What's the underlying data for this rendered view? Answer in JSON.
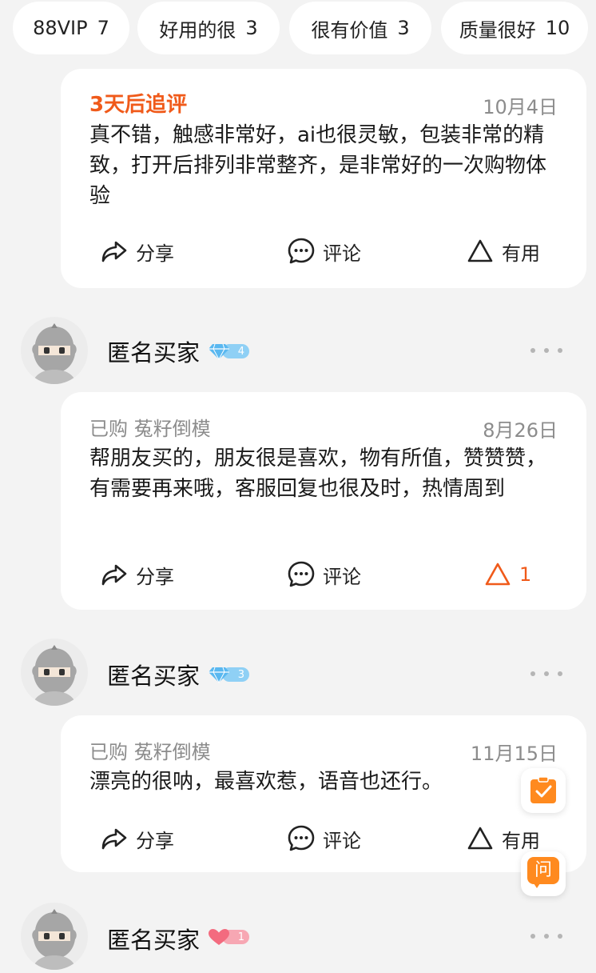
{
  "tags": [
    {
      "label": "88VIP",
      "count": "7"
    },
    {
      "label": "好用的很",
      "count": "3"
    },
    {
      "label": "很有价值",
      "count": "3"
    },
    {
      "label": "质量很好",
      "count": "10"
    }
  ],
  "actions": {
    "share": "分享",
    "comment": "评论",
    "useful": "有用"
  },
  "reviews": [
    {
      "meta": "3天后追评",
      "date": "10月4日",
      "text": "真不错，触感非常好，ai也很灵敏，包装非常的精致，打开后排列非常整齐，是非常好的一次购物体验",
      "useful_label": "有用"
    },
    {
      "user": "匿名买家",
      "level": "4",
      "meta": "已购 菟籽倒模",
      "date": "8月26日",
      "text": "帮朋友买的，朋友很是喜欢，物有所值，赞赞赞，有需要再来哦，客服回复也很及时，热情周到",
      "useful_label": "1"
    },
    {
      "user": "匿名买家",
      "level": "3",
      "meta": "已购 菟籽倒模",
      "date": "11月15日",
      "text": "漂亮的很呐，最喜欢惹，语音也还行。",
      "useful_label": "有用"
    },
    {
      "user": "匿名买家",
      "level": "1"
    }
  ],
  "floating": {
    "ask_label": "问"
  },
  "colors": {
    "accent": "#f05a1a",
    "diamond": "#5ab8f0",
    "heart": "#f36b7f",
    "float_orange": "#ff8a1f"
  }
}
